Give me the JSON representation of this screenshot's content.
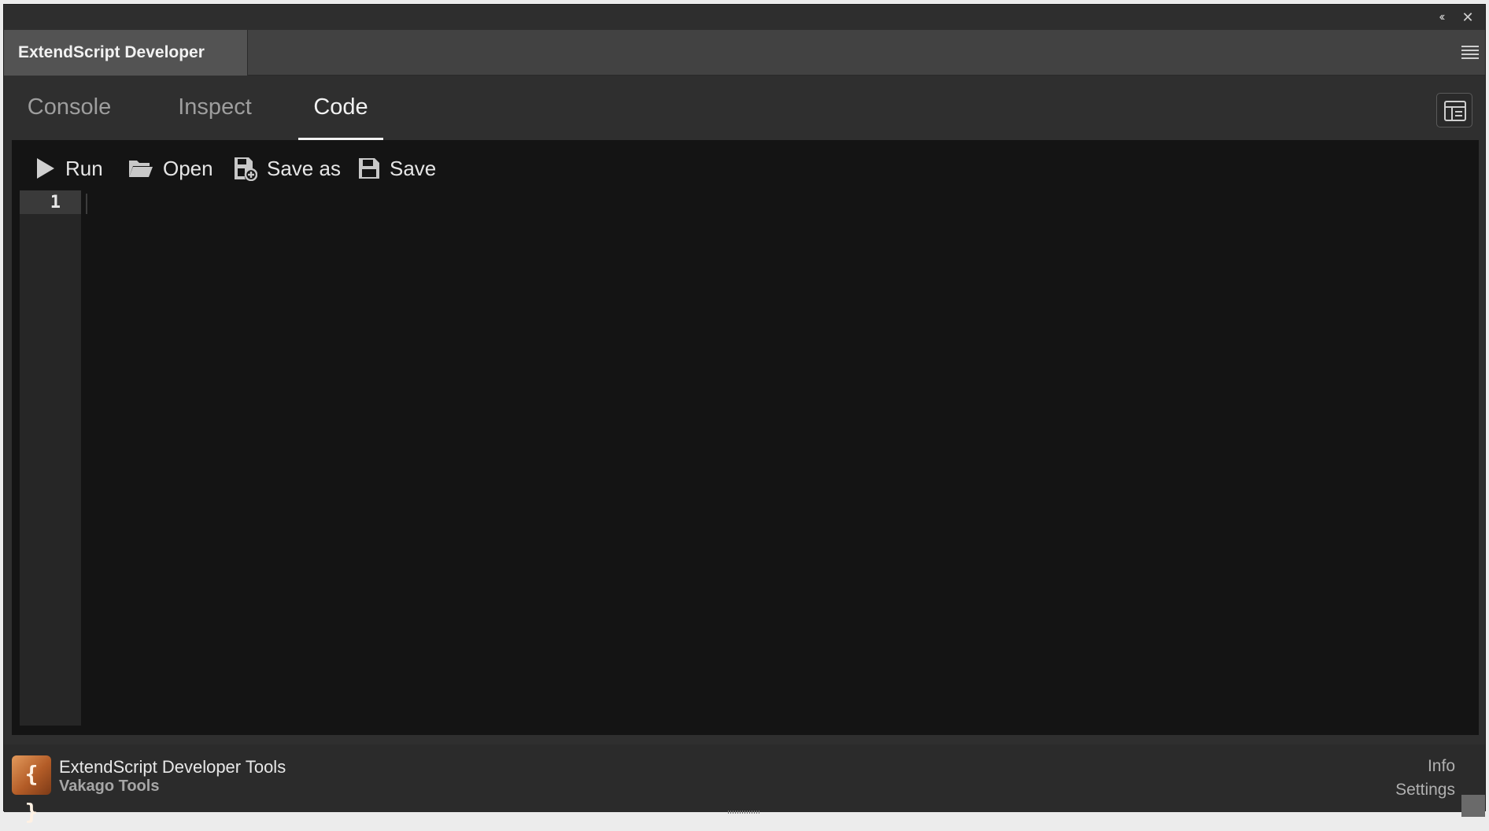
{
  "window": {
    "collapse_icon": "double-chevron-left-icon",
    "close_icon": "close-icon"
  },
  "panel": {
    "title": "ExtendScript Developer Tools",
    "menu_icon": "hamburger-menu-icon"
  },
  "tabs": [
    {
      "label": "Console",
      "active": false
    },
    {
      "label": "Inspect",
      "active": false
    },
    {
      "label": "Code",
      "active": true
    }
  ],
  "toolbar": {
    "run_label": "Run",
    "open_label": "Open",
    "save_as_label": "Save as",
    "save_label": "Save"
  },
  "editor": {
    "line_numbers": [
      "1"
    ],
    "content": ""
  },
  "footer": {
    "logo_glyph": "{ }",
    "title": "ExtendScript Developer Tools",
    "subtitle": "Vakago Tools",
    "info_label": "Info",
    "settings_label": "Settings"
  },
  "colors": {
    "panel_bg": "#323232",
    "editor_bg": "#141414",
    "accent": "#f2f2f2",
    "logo_orange": "#c86a30"
  }
}
